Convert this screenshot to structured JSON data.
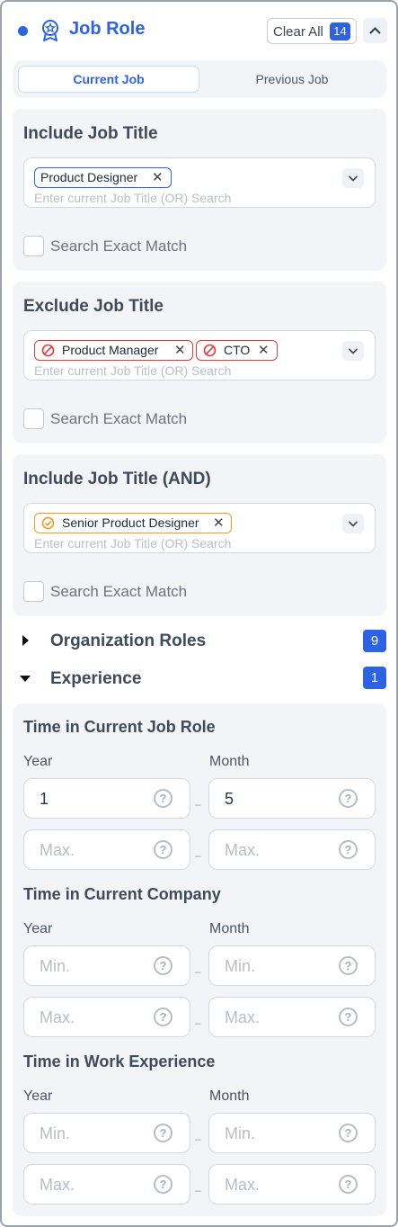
{
  "header": {
    "title": "Job Role",
    "clear_label": "Clear All",
    "clear_count": "14",
    "icon": "award-badge-icon",
    "accent": "#2d62e3"
  },
  "tabs": [
    {
      "label": "Current Job",
      "active": true
    },
    {
      "label": "Previous Job",
      "active": false
    }
  ],
  "include": {
    "title": "Include Job Title",
    "chips": [
      "Product Designer"
    ],
    "placeholder": "Enter current Job Title (OR) Search",
    "exact_label": "Search Exact Match"
  },
  "exclude": {
    "title": "Exclude Job Title",
    "chips": [
      "Product Manager",
      "CTO"
    ],
    "placeholder": "Enter current Job Title (OR) Search",
    "exact_label": "Search Exact Match"
  },
  "include_and": {
    "title": "Include Job Title (AND)",
    "chips": [
      "Senior Product Designer"
    ],
    "placeholder": "Enter current Job Title (OR) Search",
    "exact_label": "Search Exact Match"
  },
  "org_roles": {
    "label": "Organization Roles",
    "count": "9"
  },
  "experience": {
    "label": "Experience",
    "count": "1",
    "groups": [
      {
        "title": "Time in Current Job Role",
        "year_label": "Year",
        "month_label": "Month",
        "year_min": "1",
        "year_max": "Max.",
        "month_min": "5",
        "month_max": "Max."
      },
      {
        "title": "Time in Current Company",
        "year_label": "Year",
        "month_label": "Month",
        "year_min": "Min.",
        "year_max": "Max.",
        "month_min": "Min.",
        "month_max": "Max."
      },
      {
        "title": "Time in Work Experience",
        "year_label": "Year",
        "month_label": "Month",
        "year_min": "Min.",
        "year_max": "Max.",
        "month_min": "Min.",
        "month_max": "Max."
      }
    ],
    "help_glyph": "?",
    "dash": "–"
  }
}
